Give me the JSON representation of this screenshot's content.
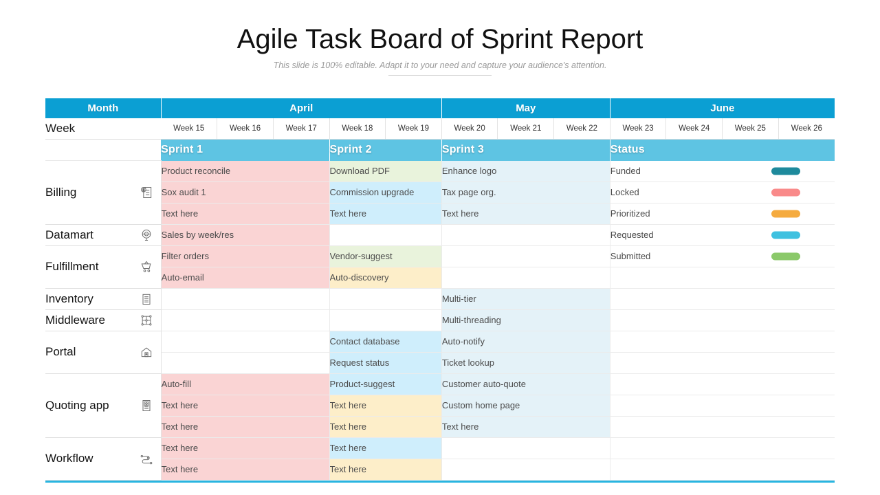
{
  "header": {
    "title": "Agile Task Board of Sprint Report",
    "subtitle": "This slide is 100% editable. Adapt it to your need and capture your audience's attention."
  },
  "table": {
    "corner_label": "Month",
    "week_row_label": "Week",
    "months": [
      {
        "name": "April",
        "span": 5
      },
      {
        "name": "May",
        "span": 3
      },
      {
        "name": "June",
        "span": 4
      }
    ],
    "weeks": [
      "Week 15",
      "Week 16",
      "Week 17",
      "Week 18",
      "Week 19",
      "Week 20",
      "Week 21",
      "Week 22",
      "Week 23",
      "Week 24",
      "Week 25",
      "Week 26"
    ],
    "sprints": [
      {
        "name": "Sprint 1",
        "span": 3
      },
      {
        "name": "Sprint 2",
        "span": 2
      },
      {
        "name": "Sprint 3",
        "span": 3
      },
      {
        "name": "Status",
        "span": 4
      }
    ],
    "rows": [
      {
        "label": "Billing",
        "icon": "invoice-icon",
        "lines": 3
      },
      {
        "label": "Datamart",
        "icon": "database-icon",
        "lines": 1
      },
      {
        "label": "Fulfillment",
        "icon": "cart-icon",
        "lines": 2
      },
      {
        "label": "Inventory",
        "icon": "warehouse-icon",
        "lines": 1
      },
      {
        "label": "Middleware",
        "icon": "grid-node-icon",
        "lines": 1
      },
      {
        "label": "Portal",
        "icon": "portal-icon",
        "lines": 2
      },
      {
        "label": "Quoting app",
        "icon": "quote-doc-icon",
        "lines": 3
      },
      {
        "label": "Workflow",
        "icon": "workflow-icon",
        "lines": 2
      }
    ],
    "cells": [
      {
        "sprint1": {
          "text": "Product reconcile",
          "color": "pink"
        },
        "sprint2": {
          "text": "Download PDF",
          "color": "green"
        },
        "sprint3": {
          "text": "Enhance logo",
          "color": "pale"
        }
      },
      {
        "sprint1": {
          "text": "Sox audit 1",
          "color": "pink"
        },
        "sprint2": {
          "text": "Commission upgrade",
          "color": "blue"
        },
        "sprint3": {
          "text": "Tax page org.",
          "color": "pale"
        }
      },
      {
        "sprint1": {
          "text": "Text here",
          "color": "pink"
        },
        "sprint2": {
          "text": "Text here",
          "color": "blue"
        },
        "sprint3": {
          "text": "Text here",
          "color": "pale"
        }
      },
      {
        "sprint1": {
          "text": "Sales by week/res",
          "color": "pink"
        },
        "sprint2": {
          "text": "",
          "color": "white"
        },
        "sprint3": {
          "text": "",
          "color": "white"
        }
      },
      {
        "sprint1": {
          "text": "Filter orders",
          "color": "pink"
        },
        "sprint2": {
          "text": "Vendor-suggest",
          "color": "green"
        },
        "sprint3": {
          "text": "",
          "color": "white"
        }
      },
      {
        "sprint1": {
          "text": "Auto-email",
          "color": "pink"
        },
        "sprint2": {
          "text": "Auto-discovery",
          "color": "cream"
        },
        "sprint3": {
          "text": "",
          "color": "white"
        }
      },
      {
        "sprint1": {
          "text": "",
          "color": "white"
        },
        "sprint2": {
          "text": "",
          "color": "white"
        },
        "sprint3": {
          "text": "Multi-tier",
          "color": "pale"
        }
      },
      {
        "sprint1": {
          "text": "",
          "color": "white"
        },
        "sprint2": {
          "text": "",
          "color": "white"
        },
        "sprint3": {
          "text": "Multi-threading",
          "color": "pale"
        }
      },
      {
        "sprint1": {
          "text": "",
          "color": "white"
        },
        "sprint2": {
          "text": "Contact database",
          "color": "blue"
        },
        "sprint3": {
          "text": "Auto-notify",
          "color": "pale"
        }
      },
      {
        "sprint1": {
          "text": "",
          "color": "white"
        },
        "sprint2": {
          "text": "Request status",
          "color": "blue"
        },
        "sprint3": {
          "text": "Ticket lookup",
          "color": "pale"
        }
      },
      {
        "sprint1": {
          "text": "Auto-fill",
          "color": "pink"
        },
        "sprint2": {
          "text": "Product-suggest",
          "color": "blue"
        },
        "sprint3": {
          "text": "Customer auto-quote",
          "color": "pale"
        }
      },
      {
        "sprint1": {
          "text": "Text here",
          "color": "pink"
        },
        "sprint2": {
          "text": "Text here",
          "color": "cream"
        },
        "sprint3": {
          "text": "Custom home page",
          "color": "pale"
        }
      },
      {
        "sprint1": {
          "text": "Text here",
          "color": "pink"
        },
        "sprint2": {
          "text": "Text here",
          "color": "cream"
        },
        "sprint3": {
          "text": "Text here",
          "color": "pale"
        }
      },
      {
        "sprint1": {
          "text": "Text here",
          "color": "pink"
        },
        "sprint2": {
          "text": "Text here",
          "color": "blue"
        },
        "sprint3": {
          "text": "",
          "color": "white"
        }
      },
      {
        "sprint1": {
          "text": "Text here",
          "color": "pink"
        },
        "sprint2": {
          "text": "Text here",
          "color": "cream"
        },
        "sprint3": {
          "text": "",
          "color": "white"
        }
      }
    ],
    "statuses": [
      {
        "label": "Funded",
        "color": "#1e8a9c"
      },
      {
        "label": "Locked",
        "color": "#f98a8a"
      },
      {
        "label": "Prioritized",
        "color": "#f5ab3f"
      },
      {
        "label": "Requested",
        "color": "#3fc1e0"
      },
      {
        "label": "Submitted",
        "color": "#8bc96a"
      },
      {
        "label": "",
        "color": ""
      },
      {
        "label": "",
        "color": ""
      },
      {
        "label": "",
        "color": ""
      },
      {
        "label": "",
        "color": ""
      },
      {
        "label": "",
        "color": ""
      },
      {
        "label": "",
        "color": ""
      },
      {
        "label": "",
        "color": ""
      },
      {
        "label": "",
        "color": ""
      },
      {
        "label": "",
        "color": ""
      },
      {
        "label": "",
        "color": ""
      }
    ]
  },
  "colors": {
    "month_header": "#0b9fd3",
    "sprint_header": "#5ec4e3",
    "accent_rule": "#29b5e0"
  }
}
